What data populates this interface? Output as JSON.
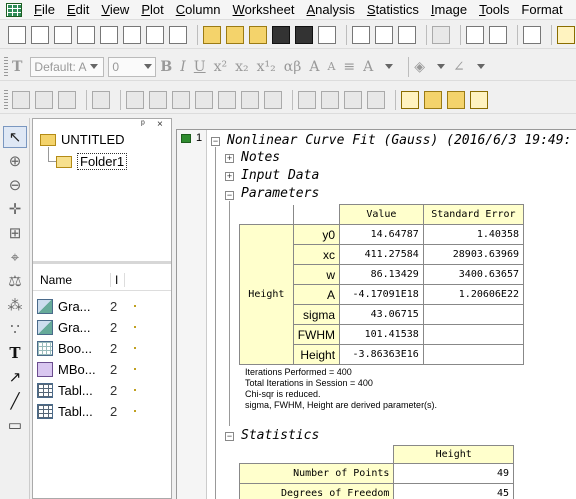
{
  "menu": {
    "items": [
      {
        "u": "F",
        "rest": "ile"
      },
      {
        "u": "E",
        "rest": "dit"
      },
      {
        "u": "V",
        "rest": "iew"
      },
      {
        "u": "P",
        "rest": "lot"
      },
      {
        "u": "C",
        "rest": "olumn"
      },
      {
        "u": "W",
        "rest": "orksheet"
      },
      {
        "u": "A",
        "rest": "nalysis"
      },
      {
        "u": "S",
        "rest": "tatistics"
      },
      {
        "u": "I",
        "rest": "mage"
      },
      {
        "u": "T",
        "rest": "ools"
      },
      {
        "u": "",
        "rest": "Format"
      }
    ]
  },
  "format_toolbar": {
    "font_name": "Default: A",
    "font_size": "0",
    "glyphs": [
      "B",
      "I",
      "U",
      "x²",
      "x₂",
      "x¹₂",
      "αβ",
      "A",
      "A"
    ]
  },
  "explorer": {
    "root_folder": "UNTITLED",
    "subfolder": "Folder1",
    "pin_label": "ᵖ",
    "close_label": "×",
    "col_name": "Name",
    "col_n": "I",
    "items": [
      {
        "label": "Gra...",
        "type": "graph",
        "n": "2"
      },
      {
        "label": "Gra...",
        "type": "graph",
        "n": "2"
      },
      {
        "label": "Boo...",
        "type": "book",
        "n": "2"
      },
      {
        "label": "MBo...",
        "type": "mbook",
        "n": "2"
      },
      {
        "label": "Tabl...",
        "type": "table",
        "n": "2"
      },
      {
        "label": "Tabl...",
        "type": "table",
        "n": "2"
      }
    ]
  },
  "report": {
    "row_number": "1",
    "title": "Nonlinear Curve Fit (Gauss) (2016/6/3 19:49:",
    "sections": {
      "notes": "Notes",
      "input": "Input Data",
      "parameters": "Parameters",
      "statistics": "Statistics"
    },
    "params_table": {
      "col_value": "Value",
      "col_error": "Standard Error",
      "group": "Height",
      "rows": [
        {
          "name": "y0",
          "value": "14.64787",
          "error": "1.40358"
        },
        {
          "name": "xc",
          "value": "411.27584",
          "error": "28903.63969"
        },
        {
          "name": "w",
          "value": "86.13429",
          "error": "3400.63657"
        },
        {
          "name": "A",
          "value": "-4.17091E18",
          "error": "1.20606E22"
        },
        {
          "name": "sigma",
          "value": "43.06715",
          "error": ""
        },
        {
          "name": "FWHM",
          "value": "101.41538",
          "error": ""
        },
        {
          "name": "Height",
          "value": "-3.86363E16",
          "error": ""
        }
      ]
    },
    "notes_lines": [
      "Iterations Performed = 400",
      "Total Iterations in Session = 400",
      "Chi-sqr is reduced.",
      "sigma, FWHM, Height are derived parameter(s)."
    ],
    "stats_table": {
      "col": "Height",
      "rows": [
        {
          "name": "Number of Points",
          "value": "49"
        },
        {
          "name": "Degrees of Freedom",
          "value": "45"
        }
      ]
    }
  }
}
